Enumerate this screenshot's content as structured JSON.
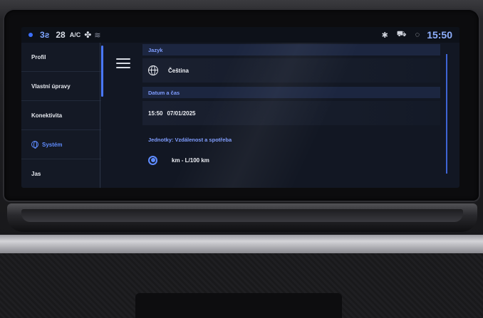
{
  "status_bar": {
    "seat_heat": "3",
    "temperature": "28",
    "ac_label": "A/C",
    "fan_icon": "fan-icon",
    "defrost_icon": "rear-defrost-icon",
    "bluetooth_icon": "bluetooth-icon",
    "car_icon": "car-connect-icon",
    "signal_icon": "signal-icon",
    "time": "15:50",
    "accent_color": "#8fb0ff"
  },
  "sidebar": {
    "items": [
      {
        "label": "Profil",
        "active": false
      },
      {
        "label": "Vlastní úpravy",
        "active": false
      },
      {
        "label": "Konektivita",
        "active": false
      },
      {
        "label": "Systém",
        "active": true,
        "icon": "globe-icon"
      },
      {
        "label": "Jas",
        "active": false
      }
    ],
    "active_color": "#5f8cff"
  },
  "menu_icon": "hamburger-menu-icon",
  "content": {
    "language": {
      "header": "Jazyk",
      "value": "Čeština",
      "icon": "globe-icon"
    },
    "datetime": {
      "header": "Datum a čas",
      "time": "15:50",
      "date": "07/01/2025"
    },
    "units": {
      "header": "Jednotky: Vzdálenost a spotřeba",
      "selected_option": "km - L/100 km",
      "icon": "radio-selected-icon"
    }
  }
}
